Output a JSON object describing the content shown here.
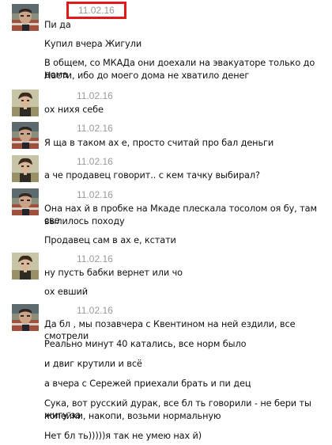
{
  "messages": [
    {
      "date": "11.02.16",
      "avatar": "user-a",
      "lines": [
        "Пи да",
        "Купил вчера Жигули",
        "В общем, со МКАДа они доехали на эвакуаторе только до дома",
        "Насти, ибо до моего дома не хватило денег"
      ]
    },
    {
      "date": "11.02.16",
      "avatar": "user-b",
      "lines": [
        "ох нихя себе"
      ]
    },
    {
      "date": "11.02.16",
      "avatar": "user-a",
      "lines": [
        "Я ща в таком ах  е, просто считай про  бал деньги"
      ]
    },
    {
      "date": "11.02.16",
      "avatar": "user-b",
      "lines": [
        "а че продавец говорит.. с кем тачку выбирал?"
      ]
    },
    {
      "date": "11.02.16",
      "avatar": "user-a",
      "lines": [
        "Она нах  й в пробке на Мкаде плескала тосолом оя  бу, там све",
        "вылилось походу",
        "Продавец сам в ах  е, кстати"
      ]
    },
    {
      "date": "11.02.16",
      "avatar": "user-b",
      "lines": [
        "ну пусть бабки вернет или чо",
        "ох  евший"
      ]
    },
    {
      "date": "11.02.16",
      "avatar": "user-a",
      "lines": [
        "Да бл  , мы позавчера с Квентином на ней ездили, все смотрели",
        "Реально минут 40 катались, все норм было",
        "и двиг крутили и всё",
        "а вчера с Сережей приехали брать и пи  дец",
        "Сука, вот русский дурак, все бл  ть говорили - не бери ты жигу за",
        "копейки, накопи, возьми нормальную",
        "Нет бл  ть)))))я так не умею нах  й)"
      ]
    }
  ]
}
